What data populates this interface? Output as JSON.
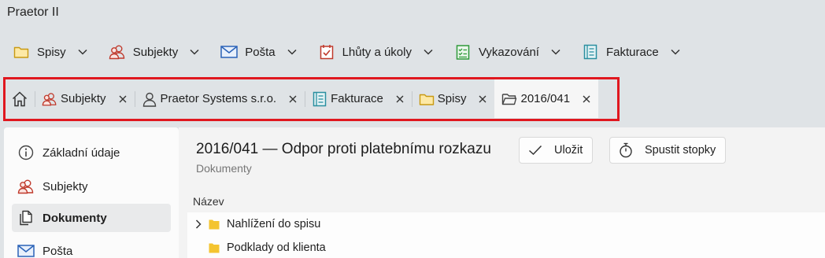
{
  "app": {
    "title": "Praetor II"
  },
  "menu": [
    {
      "label": "Spisy",
      "icon": "folder-icon"
    },
    {
      "label": "Subjekty",
      "icon": "people-icon"
    },
    {
      "label": "Pošta",
      "icon": "mail-icon"
    },
    {
      "label": "Lhůty a úkoly",
      "icon": "calendar-check-icon"
    },
    {
      "label": "Vykazování",
      "icon": "checklist-icon"
    },
    {
      "label": "Fakturace",
      "icon": "invoice-icon"
    }
  ],
  "tabs": [
    {
      "label": "Subjekty",
      "icon": "people-icon"
    },
    {
      "label": "Praetor Systems s.r.o.",
      "icon": "person-icon"
    },
    {
      "label": "Fakturace",
      "icon": "invoice-icon"
    },
    {
      "label": "Spisy",
      "icon": "folder-icon"
    },
    {
      "label": "2016/041",
      "icon": "open-folder-icon",
      "active": true
    }
  ],
  "sidebar": {
    "items": [
      {
        "label": "Základní údaje",
        "icon": "info-icon"
      },
      {
        "label": "Subjekty",
        "icon": "people-icon"
      },
      {
        "label": "Dokumenty",
        "icon": "documents-icon",
        "active": true
      },
      {
        "label": "Pošta",
        "icon": "mail-icon"
      }
    ]
  },
  "main": {
    "title": "2016/041 — Odpor proti platebnímu rozkazu",
    "subtitle": "Dokumenty",
    "save_label": "Uložit",
    "stopwatch_label": "Spustit stopky",
    "column_header": "Název",
    "rows": [
      {
        "label": "Nahlížení do spisu",
        "expandable": true
      },
      {
        "label": "Podklady od klienta",
        "expandable": false
      }
    ]
  },
  "colors": {
    "highlight_frame": "#e0171f",
    "folder_yellow": "#f4c430",
    "people_red": "#c0392b",
    "mail_blue": "#2a62b8",
    "invoice_teal": "#2a8fa0",
    "checklist_green": "#2f9a3a"
  }
}
